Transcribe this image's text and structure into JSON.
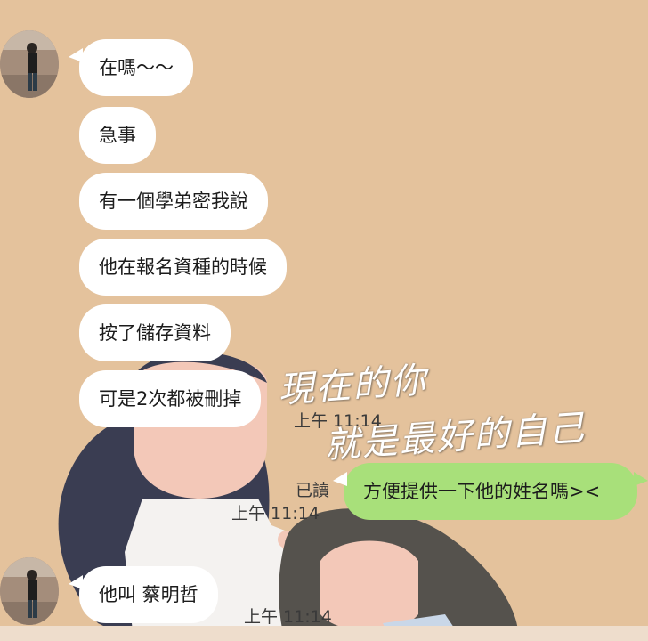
{
  "wallpaper": {
    "overlay_line1": "現在的你",
    "overlay_line2": "就是最好的自己"
  },
  "messages": [
    {
      "text": "在嗎〜〜",
      "sender": "other"
    },
    {
      "text": "急事",
      "sender": "other"
    },
    {
      "text": "有一個學弟密我說",
      "sender": "other"
    },
    {
      "text": "他在報名資種的時候",
      "sender": "other"
    },
    {
      "text": "按了儲存資料",
      "sender": "other"
    },
    {
      "text": "可是2次都被刪掉",
      "sender": "other",
      "time": "上午 11:14"
    },
    {
      "text": "方便提供一下他的姓名嗎><",
      "sender": "me",
      "read": "已讀",
      "time": "上午 11:14"
    },
    {
      "text": "他叫 蔡明哲",
      "sender": "other",
      "time": "上午 11:14"
    }
  ],
  "colors": {
    "background": "#e4c29c",
    "incoming_bubble": "#ffffff",
    "outgoing_bubble": "#a8e07a"
  }
}
